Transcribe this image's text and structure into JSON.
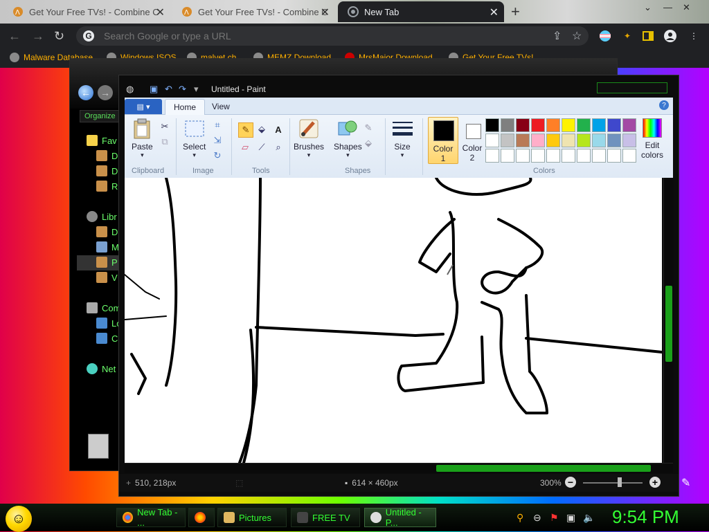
{
  "browser": {
    "tabs": [
      {
        "label": "Get Your Free TVs! - Combine C",
        "active": false
      },
      {
        "label": "Get Your Free TVs! - Combine C",
        "active": false
      },
      {
        "label": "New Tab",
        "active": true
      }
    ],
    "new_tab_symbol": "+",
    "omnibox_placeholder": "Search Google or type a URL",
    "bookmarks": [
      {
        "label": "Malware Database"
      },
      {
        "label": "Windows ISOS"
      },
      {
        "label": "malvet.ch"
      },
      {
        "label": "MEMZ Download"
      },
      {
        "label": "MrsMajor Download"
      },
      {
        "label": "Get Your Free TVs!"
      }
    ]
  },
  "explorer": {
    "organize": "Organize",
    "items": [
      {
        "label": "Fav",
        "color": "#f6d24a"
      },
      {
        "label": "D",
        "color": "#c9904a"
      },
      {
        "label": "D",
        "color": "#c9904a"
      },
      {
        "label": "R",
        "color": "#c9904a"
      },
      {
        "label": "Libr",
        "color": "#888888"
      },
      {
        "label": "D",
        "color": "#c9904a"
      },
      {
        "label": "M",
        "color": "#7aa0d0"
      },
      {
        "label": "P",
        "color": "#c9904a"
      },
      {
        "label": "V",
        "color": "#c9904a"
      },
      {
        "label": "Com",
        "color": "#aaaaaa"
      },
      {
        "label": "Lo",
        "color": "#4a8ad0"
      },
      {
        "label": "C",
        "color": "#4a8ad0"
      },
      {
        "label": "Net",
        "color": "#4ad0c0"
      }
    ]
  },
  "paint": {
    "title": "Untitled - Paint",
    "tabs": [
      "Home",
      "View"
    ],
    "groups": {
      "clipboard": "Clipboard",
      "image": "Image",
      "tools": "Tools",
      "shapes": "Shapes",
      "colors": "Colors"
    },
    "buttons": {
      "paste": "Paste",
      "select": "Select",
      "brushes": "Brushes",
      "shapes": "Shapes",
      "size": "Size",
      "color1": [
        "Color",
        "1"
      ],
      "color2": [
        "Color",
        "2"
      ],
      "edit_colors": [
        "Edit",
        "colors"
      ]
    },
    "color1_value": "#000000",
    "color2_value": "#ffffff",
    "palette": [
      "#000000",
      "#7f7f7f",
      "#880015",
      "#ed1c24",
      "#ff7f27",
      "#fff200",
      "#22b14c",
      "#00a2e8",
      "#3f48cc",
      "#a349a4",
      "#ffffff",
      "#c3c3c3",
      "#b97a57",
      "#ffaec9",
      "#ffc90e",
      "#efe4b0",
      "#b5e61d",
      "#99d9ea",
      "#7092be",
      "#c8bfe7",
      "#ffffff",
      "#ffffff",
      "#ffffff",
      "#ffffff",
      "#ffffff",
      "#ffffff",
      "#ffffff",
      "#ffffff",
      "#ffffff",
      "#ffffff"
    ],
    "status": {
      "cursor": "510, 218px",
      "size": "614 × 460px",
      "zoom": "300%"
    }
  },
  "taskbar": {
    "tasks": [
      {
        "label": "New Tab - ...",
        "active": false
      },
      {
        "label": "",
        "active": false
      },
      {
        "label": "Pictures",
        "active": false
      },
      {
        "label": "FREE TV",
        "active": false
      },
      {
        "label": "Untitled - P...",
        "active": true
      }
    ],
    "clock": "9:54 PM"
  }
}
